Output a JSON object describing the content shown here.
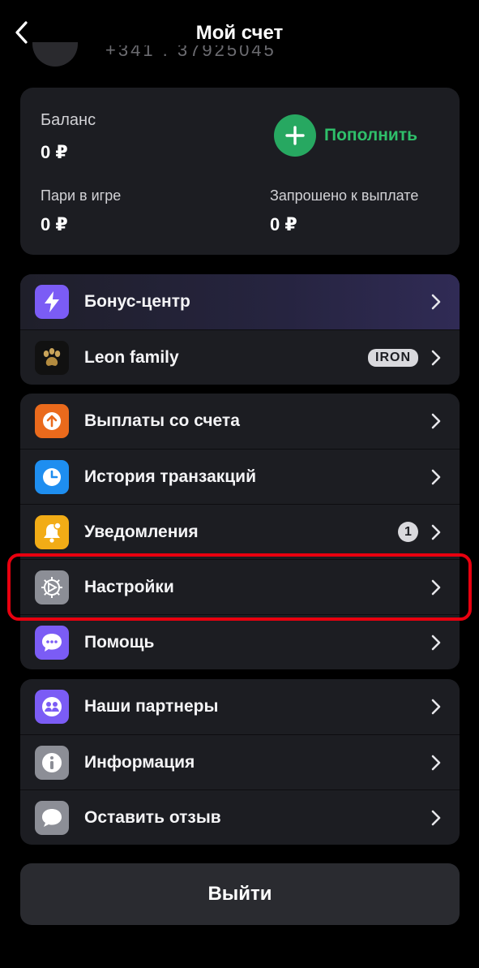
{
  "header": {
    "title": "Мой счет",
    "phone_partial": "+341 . 37925045"
  },
  "balance": {
    "label": "Баланс",
    "value": "0 ₽",
    "topup_label": "Пополнить",
    "bets_label": "Пари в игре",
    "bets_value": "0 ₽",
    "withdraw_label": "Запрошено к выплате",
    "withdraw_value": "0 ₽"
  },
  "groups": {
    "bonus": [
      {
        "label": "Бонус-центр",
        "icon": "lightning-icon",
        "color": "#7b5cf5"
      },
      {
        "label": "Leon family",
        "icon": "paw-icon",
        "badge": "IRON",
        "color": "#111111"
      }
    ],
    "account": [
      {
        "label": "Выплаты со счета",
        "icon": "withdraw-arrow-icon",
        "color": "#ea6a1c"
      },
      {
        "label": "История транзакций",
        "icon": "clock-icon",
        "color": "#1e8ef0"
      },
      {
        "label": "Уведомления",
        "icon": "bell-icon",
        "badge": "1",
        "color": "#f2ac16"
      },
      {
        "label": "Настройки",
        "icon": "gear-icon",
        "color": "#8c8e96"
      },
      {
        "label": "Помощь",
        "icon": "chat-bubble-icon",
        "color": "#7b5cf5"
      }
    ],
    "info": [
      {
        "label": "Наши партнеры",
        "icon": "partners-icon",
        "color": "#7b5cf5"
      },
      {
        "label": "Информация",
        "icon": "info-icon",
        "color": "#8c8e96"
      },
      {
        "label": "Оставить отзыв",
        "icon": "feedback-bubble-icon",
        "color": "#8c8e96"
      }
    ]
  },
  "logout_label": "Выйти",
  "colors": {
    "accent_green": "#27a861",
    "highlight": "#e8000f",
    "card": "#1c1d22",
    "background": "#000000"
  }
}
